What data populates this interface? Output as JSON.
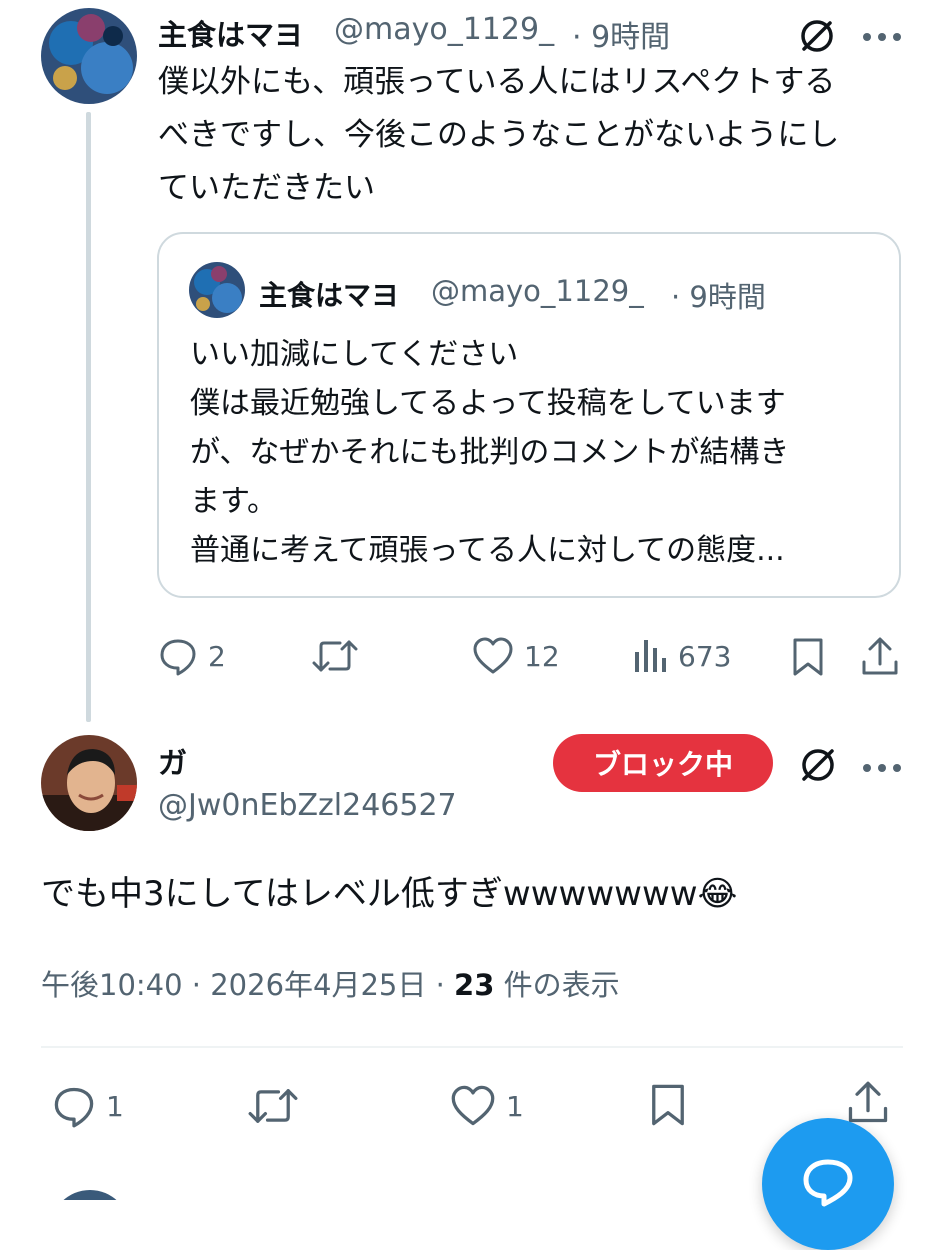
{
  "first_tweet": {
    "author_name": "主食はマヨ",
    "handle": "@mayo_1129_",
    "time": "· 9時間",
    "text_lines": [
      "僕以外にも、頑張っている人にはリスペクトする",
      "べきですし、今後このようなことがないようにし",
      "ていただきたい"
    ],
    "quote": {
      "author_name": "主食はマヨ",
      "handle": "@mayo_1129_",
      "time": "· 9時間",
      "text_lines": [
        "いい加減にしてください",
        "僕は最近勉強してるよって投稿をしています",
        "が、なぜかそれにも批判のコメントが結構き",
        "ます。",
        "普通に考えて頑張ってる人に対しての態度..."
      ]
    },
    "actions": {
      "replies": "2",
      "retweets": "",
      "likes": "12",
      "views": "673"
    }
  },
  "main_tweet": {
    "author_name": "ガ",
    "handle": "@Jw0nEbZzl246527",
    "blocked_label": "ブロック中",
    "text": "でも中3にしてはレベル低すぎwwwwwww",
    "emoji": "😂",
    "meta_time": "午後10:40 · 2026年4月25日 · ",
    "meta_views_count": "23",
    "meta_views_label": " 件の表示",
    "actions": {
      "replies": "1",
      "retweets": "",
      "likes": "1"
    }
  },
  "colors": {
    "accent": "#1d9bf0",
    "blocked": "#e5333f",
    "muted": "#536471",
    "thread_line": "#cfd9de"
  },
  "icons": [
    "reply-icon",
    "retweet-icon",
    "like-icon",
    "views-icon",
    "bookmark-icon",
    "share-icon",
    "grok-icon",
    "more-icon",
    "compose-icon"
  ]
}
